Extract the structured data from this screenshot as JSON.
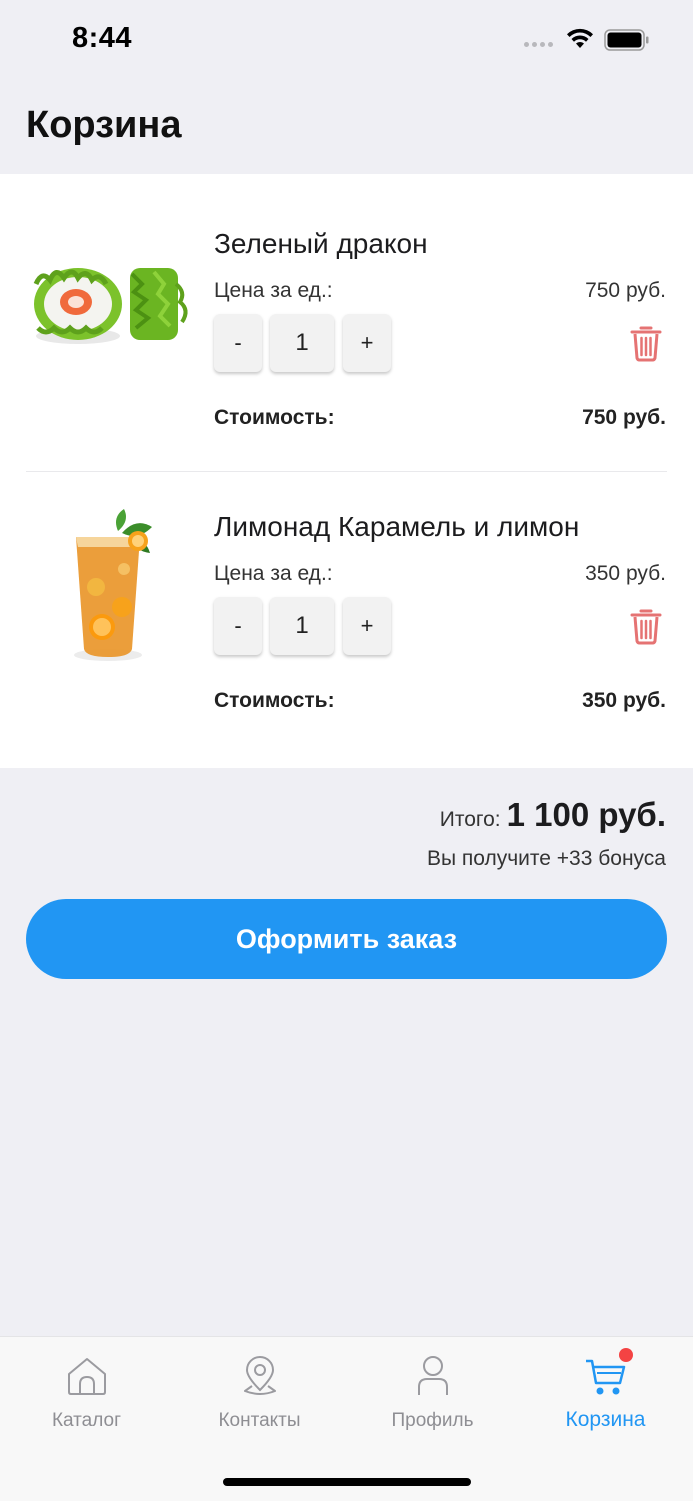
{
  "status_bar": {
    "time": "8:44"
  },
  "header": {
    "title": "Корзина"
  },
  "cart": {
    "items": [
      {
        "name": "Зеленый дракон",
        "price_label": "Цена за ед.:",
        "price": "750 руб.",
        "qty_minus": "-",
        "quantity": "1",
        "qty_plus": "+",
        "cost_label": "Стоимость:",
        "cost": "750 руб.",
        "image": "sushi-roll-green-dragon"
      },
      {
        "name": "Лимонад Карамель и лимон",
        "price_label": "Цена за ед.:",
        "price": "350 руб.",
        "qty_minus": "-",
        "quantity": "1",
        "qty_plus": "+",
        "cost_label": "Стоимость:",
        "cost": "350 руб.",
        "image": "lemonade-glass"
      }
    ]
  },
  "summary": {
    "total_label": "Итого:",
    "total_value": "1 100 руб.",
    "bonus_text": "Вы получите +33 бонуса"
  },
  "order_button": {
    "label": "Оформить заказ",
    "color": "#2196f3"
  },
  "tab_bar": {
    "items": [
      {
        "label": "Каталог",
        "icon": "home-icon",
        "active": false
      },
      {
        "label": "Контакты",
        "icon": "location-pin-icon",
        "active": false
      },
      {
        "label": "Профиль",
        "icon": "user-icon",
        "active": false
      },
      {
        "label": "Корзина",
        "icon": "cart-icon",
        "active": true
      }
    ],
    "active_color": "#2196f3",
    "badge_color": "#f44343"
  },
  "colors": {
    "delete_icon": "#e57373",
    "background": "#efeff4"
  }
}
